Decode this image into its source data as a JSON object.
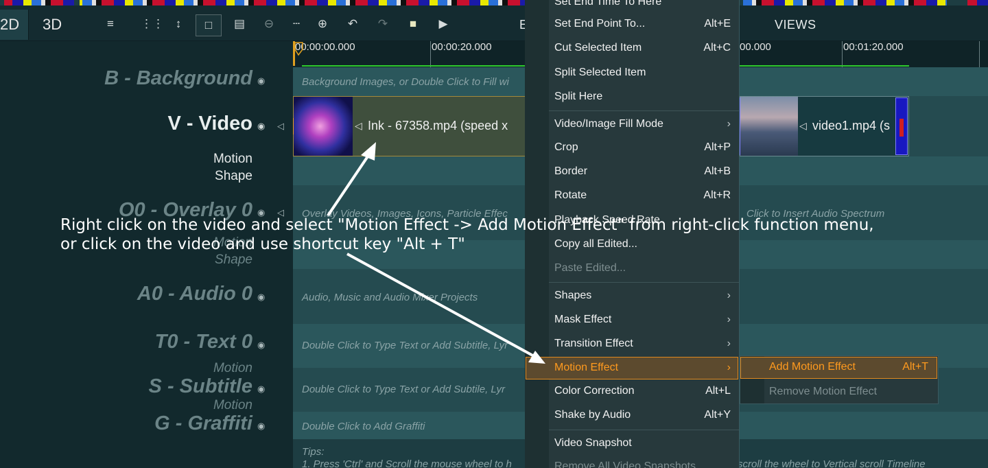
{
  "toolbar": {
    "tabs": [
      "2D",
      "3D"
    ],
    "views_label": "VIEWS",
    "edit_label": "E",
    "icons": [
      "align-left-icon",
      "grid-icon",
      "vertical-arrows-icon",
      "select-icon",
      "fit-icon",
      "zoom-out-icon",
      "ruler-icon",
      "zoom-in-icon",
      "undo-icon",
      "redo-icon",
      "stop-icon",
      "play-icon"
    ]
  },
  "ruler": {
    "labels": [
      "00:00:00.000",
      "00:00:20.000",
      "00.000",
      "00:01:20.000"
    ]
  },
  "tracks": {
    "background": {
      "name": "B - Background",
      "hint": "Background Images, or Double Click to Fill wi"
    },
    "video": {
      "name": "V - Video",
      "sub1": "Motion",
      "sub2": "Shape"
    },
    "overlay": {
      "name": "O0 - Overlay 0",
      "sub1": "Motion",
      "sub2": "Shape",
      "hint": "Overlay Videos, Images, Icons, Particle Effec",
      "hint2": "Click to Insert Audio Spectrum"
    },
    "audio": {
      "name": "A0 - Audio 0",
      "hint": "Audio, Music and Audio Mixer Projects"
    },
    "text": {
      "name": "T0 - Text 0",
      "sub": "Motion",
      "hint": "Double Click to Type Text or Add Subtitle, Lyr"
    },
    "subtitle": {
      "name": "S - Subtitle",
      "sub": "Motion",
      "hint": "Double Click to Type Text or Add Subtile, Lyr"
    },
    "graffiti": {
      "name": "G - Graffiti",
      "hint": "Double Click to Add Graffiti"
    }
  },
  "clips": {
    "clip1": "Ink - 67358.mp4  (speed x",
    "clip2": "video1.mp4  (s"
  },
  "tips": {
    "title": "Tips:",
    "line1": "1. Press 'Ctrl' and Scroll the mouse wheel to h",
    "line1_end": "scroll the wheel to Vertical scroll Timeline"
  },
  "menu": {
    "items": [
      {
        "label": "Set End Time To Here",
        "shortcut": ""
      },
      {
        "label": "Set End Point To...",
        "shortcut": "Alt+E"
      },
      {
        "label": "Cut Selected Item",
        "shortcut": "Alt+C"
      },
      {
        "label": "Split Selected Item",
        "shortcut": ""
      },
      {
        "label": "Split Here",
        "shortcut": ""
      },
      {
        "label": "Video/Image Fill Mode",
        "shortcut": ""
      },
      {
        "label": "Crop",
        "shortcut": "Alt+P"
      },
      {
        "label": "Border",
        "shortcut": "Alt+B"
      },
      {
        "label": "Rotate",
        "shortcut": "Alt+R"
      },
      {
        "label": "Playback Speed Rate",
        "shortcut": ""
      },
      {
        "label": "Copy all Edited...",
        "shortcut": ""
      },
      {
        "label": "Paste Edited...",
        "shortcut": ""
      },
      {
        "label": "Shapes",
        "shortcut": ""
      },
      {
        "label": "Mask Effect",
        "shortcut": ""
      },
      {
        "label": "Transition Effect",
        "shortcut": ""
      },
      {
        "label": "Motion Effect",
        "shortcut": ""
      },
      {
        "label": "Color Correction",
        "shortcut": "Alt+L"
      },
      {
        "label": "Shake by Audio",
        "shortcut": "Alt+Y"
      },
      {
        "label": "Video Snapshot",
        "shortcut": ""
      },
      {
        "label": "Remove All Video Snapshots",
        "shortcut": ""
      }
    ]
  },
  "submenu": {
    "add": {
      "label": "Add Motion Effect",
      "shortcut": "Alt+T"
    },
    "remove": {
      "label": "Remove Motion Effect"
    }
  },
  "callout": {
    "line1": "Right click on the video and select \"Motion Effect -> Add Motion Effect\" from right-click function menu,",
    "line2": "or click on the video and use shortcut key \"Alt + T\""
  },
  "colors": {
    "accent": "#ff9a1e",
    "highlight_border": "#e08a20",
    "playhead_line": "#2ecc2e"
  }
}
